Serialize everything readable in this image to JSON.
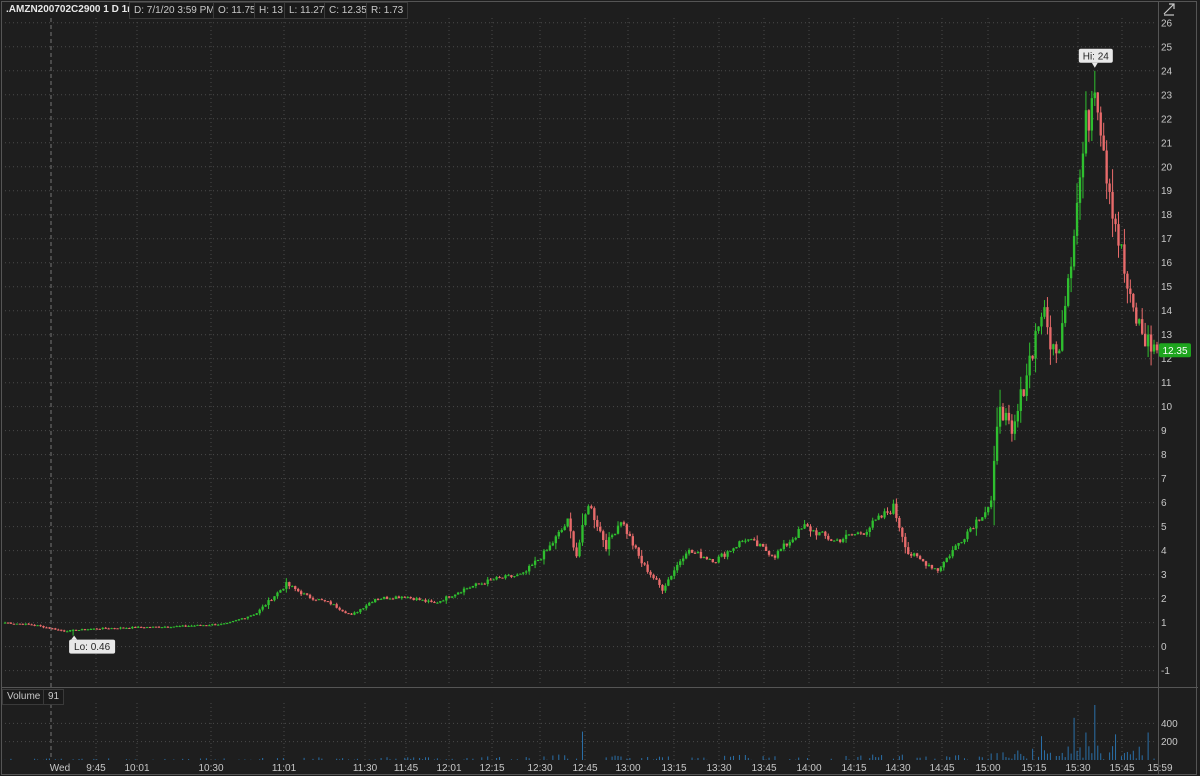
{
  "header": {
    "symbol": ".AMZN200702C2900 1 D 1m",
    "date": "D: 7/1/20 3:59 PM",
    "open": "O: 11.75",
    "high": "H: 13",
    "low": "L: 11.27",
    "close": "C: 12.35",
    "range": "R: 1.73"
  },
  "volume_panel": {
    "label": "Volume",
    "value": "91"
  },
  "markers": {
    "hi_label": "Hi: 24",
    "lo_label": "Lo: 0.46",
    "last_price": "12.35"
  },
  "colors": {
    "up": "#2fbf2f",
    "down": "#e86b6b",
    "volume": "#2a6fa8",
    "last_badge": "#1ea51e",
    "bg": "#1e1e1e",
    "grid": "#4a4a4a"
  },
  "chart_data": [
    {
      "type": "candlestick",
      "ylim": [
        -1.6,
        26.2
      ],
      "yticks": [
        -1,
        0,
        1,
        2,
        3,
        4,
        5,
        6,
        7,
        8,
        9,
        10,
        11,
        12,
        13,
        14,
        15,
        16,
        17,
        18,
        19,
        20,
        21,
        22,
        23,
        24,
        25,
        26
      ],
      "xtick_labels": [
        "Wed",
        "9:45",
        "10:01",
        "10:30",
        "11:01",
        "11:30",
        "11:45",
        "12:01",
        "12:15",
        "12:30",
        "12:45",
        "13:00",
        "13:15",
        "13:30",
        "13:45",
        "14:00",
        "14:15",
        "14:30",
        "14:45",
        "15:00",
        "15:15",
        "15:30",
        "15:45",
        "15:59"
      ],
      "session": {
        "start": "9:30",
        "end": "15:59",
        "interval_minutes": 1
      },
      "price_path": [
        [
          "9:30",
          1.0
        ],
        [
          "9:40",
          0.9
        ],
        [
          "9:50",
          0.65
        ],
        [
          "10:01",
          0.75
        ],
        [
          "10:15",
          0.8
        ],
        [
          "10:30",
          0.85
        ],
        [
          "10:45",
          0.95
        ],
        [
          "10:55",
          1.4
        ],
        [
          "11:05",
          2.6
        ],
        [
          "11:12",
          2.1
        ],
        [
          "11:20",
          1.8
        ],
        [
          "11:27",
          1.3
        ],
        [
          "11:35",
          2.0
        ],
        [
          "11:45",
          2.1
        ],
        [
          "11:55",
          1.8
        ],
        [
          "12:05",
          2.4
        ],
        [
          "12:15",
          2.8
        ],
        [
          "12:25",
          3.0
        ],
        [
          "12:33",
          4.0
        ],
        [
          "12:40",
          5.2
        ],
        [
          "12:43",
          3.8
        ],
        [
          "12:47",
          6.0
        ],
        [
          "12:53",
          4.2
        ],
        [
          "12:58",
          5.3
        ],
        [
          "13:05",
          3.5
        ],
        [
          "13:12",
          2.4
        ],
        [
          "13:20",
          4.0
        ],
        [
          "13:30",
          3.6
        ],
        [
          "13:40",
          4.5
        ],
        [
          "13:50",
          3.8
        ],
        [
          "14:00",
          5.0
        ],
        [
          "14:10",
          4.4
        ],
        [
          "14:20",
          4.8
        ],
        [
          "14:30",
          5.8
        ],
        [
          "14:35",
          3.9
        ],
        [
          "14:45",
          3.2
        ],
        [
          "14:55",
          4.8
        ],
        [
          "15:03",
          6.0
        ],
        [
          "15:06",
          10.3
        ],
        [
          "15:10",
          8.6
        ],
        [
          "15:15",
          11.5
        ],
        [
          "15:20",
          14.0
        ],
        [
          "15:25",
          12.0
        ],
        [
          "15:30",
          16.5
        ],
        [
          "15:35",
          21.5
        ],
        [
          "15:38",
          24.0
        ],
        [
          "15:42",
          20.0
        ],
        [
          "15:46",
          17.0
        ],
        [
          "15:50",
          14.2
        ],
        [
          "15:55",
          12.8
        ],
        [
          "15:59",
          12.35
        ]
      ],
      "high": {
        "value": 24,
        "time": "15:38"
      },
      "low": {
        "value": 0.46,
        "time": "9:53"
      },
      "last": 12.35
    },
    {
      "type": "bar",
      "name": "Volume",
      "ylim": [
        0,
        600
      ],
      "yticks": [
        200,
        400
      ],
      "notable_bars": [
        [
          "15:38",
          600
        ],
        [
          "15:31",
          460
        ],
        [
          "12:45",
          310
        ],
        [
          "15:20",
          260
        ],
        [
          "15:35",
          300
        ],
        [
          "15:45",
          280
        ],
        [
          "15:56",
          300
        ]
      ]
    }
  ]
}
